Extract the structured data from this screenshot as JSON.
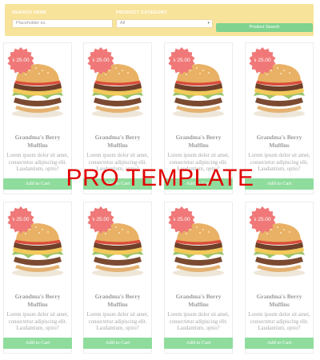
{
  "search": {
    "label_search": "SEARCH HERE",
    "placeholder": "Placeholder ex.",
    "label_category": "PRODUCT CATEGORY",
    "category_value": "All",
    "button_label": "Product Search"
  },
  "products": [
    {
      "price": "৳ 25.00",
      "title_line1": "Grandma's Berry",
      "title_line2": "Muffins",
      "desc_line1": "Lorem ipsum dolor sit amet,",
      "desc_line2": "consectetur adipiscing elit.",
      "desc_line3": "Laudantium, optio?",
      "cart_label": "Add to Cart"
    },
    {
      "price": "৳ 25.00",
      "title_line1": "Grandma's Berry",
      "title_line2": "Muffins",
      "desc_line1": "Lorem ipsum dolor sit amet,",
      "desc_line2": "consectetur adipiscing elit.",
      "desc_line3": "Laudantium, optio?",
      "cart_label": "Add to Cart"
    },
    {
      "price": "৳ 25.00",
      "title_line1": "Grandma's Berry",
      "title_line2": "Muffins",
      "desc_line1": "Lorem ipsum dolor sit amet,",
      "desc_line2": "consectetur adipiscing elit.",
      "desc_line3": "Laudantium, optio?",
      "cart_label": "Add to Cart"
    },
    {
      "price": "৳ 25.00",
      "title_line1": "Grandma's Berry",
      "title_line2": "Muffins",
      "desc_line1": "Lorem ipsum dolor sit amet,",
      "desc_line2": "consectetur adipiscing elit.",
      "desc_line3": "Laudantium, optio?",
      "cart_label": "Add to Cart"
    },
    {
      "price": "৳ 25.00",
      "title_line1": "Grandma's Berry",
      "title_line2": "Muffins",
      "desc_line1": "Lorem ipsum dolor sit amet,",
      "desc_line2": "consectetur adipiscing elit.",
      "desc_line3": "Laudantium, optio?",
      "cart_label": "Add to Cart"
    },
    {
      "price": "৳ 25.00",
      "title_line1": "Grandma's Berry",
      "title_line2": "Muffins",
      "desc_line1": "Lorem ipsum dolor sit amet,",
      "desc_line2": "consectetur adipiscing elit.",
      "desc_line3": "Laudantium, optio?",
      "cart_label": "Add to Cart"
    },
    {
      "price": "৳ 25.00",
      "title_line1": "Grandma's Berry",
      "title_line2": "Muffins",
      "desc_line1": "Lorem ipsum dolor sit amet,",
      "desc_line2": "consectetur adipiscing elit.",
      "desc_line3": "Laudantium, optio?",
      "cart_label": "Add to Cart"
    },
    {
      "price": "৳ 25.00",
      "title_line1": "Grandma's Berry",
      "title_line2": "Muffins",
      "desc_line1": "Lorem ipsum dolor sit amet,",
      "desc_line2": "consectetur adipiscing elit.",
      "desc_line3": "Laudantium, optio?",
      "cart_label": "Add to Cart"
    }
  ],
  "watermark": "PRO TEMPLATE",
  "colors": {
    "search_bar": "#f8e39a",
    "badge": "#f07878",
    "cart_button": "#8fdc9d",
    "search_button": "#7fd38f",
    "watermark": "#e00000"
  },
  "icons": {
    "product_image": "burger-image",
    "price_badge": "starburst-badge-icon",
    "select_arrow": "chevron-down-icon"
  }
}
